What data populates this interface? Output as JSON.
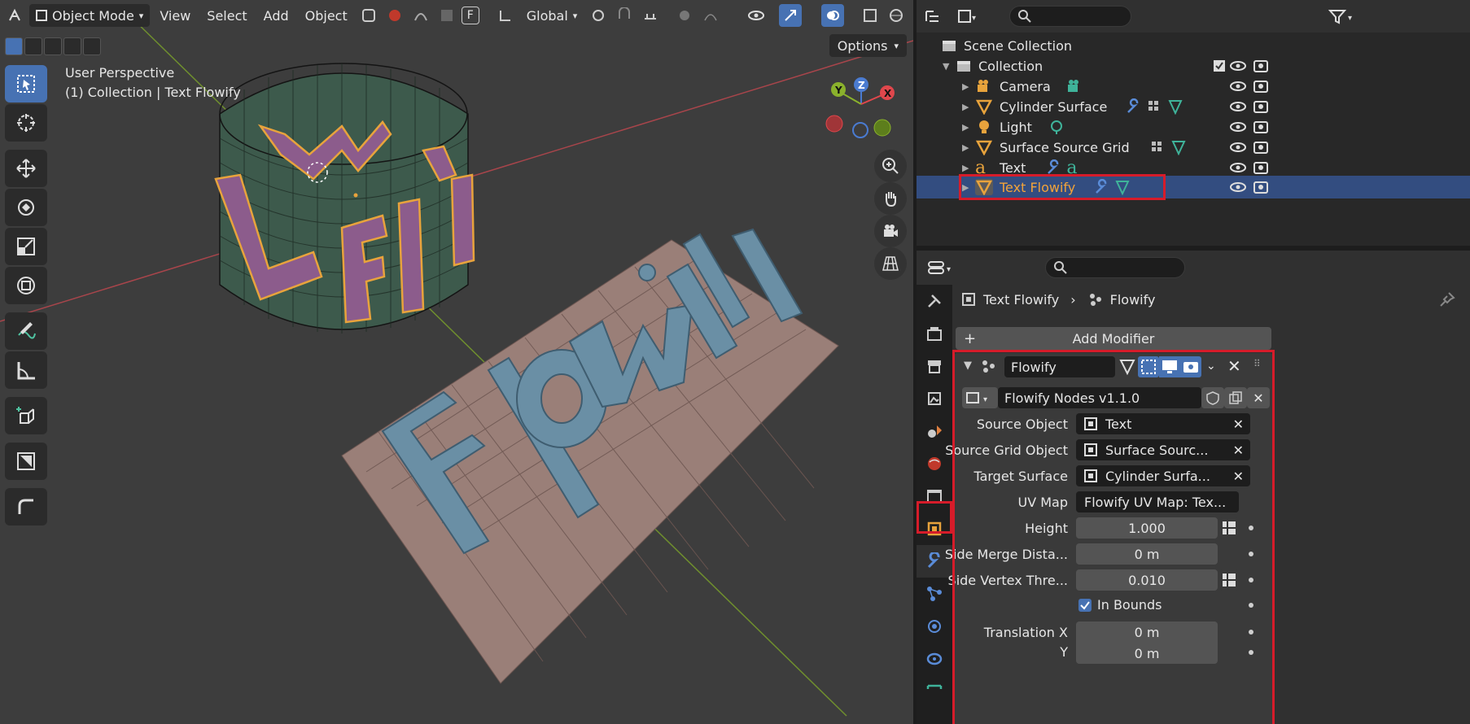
{
  "header": {
    "mode": "Object Mode",
    "menus": [
      "View",
      "Select",
      "Add",
      "Object"
    ],
    "orientation": "Global",
    "options": "Options"
  },
  "viewport": {
    "perspective": "User Perspective",
    "collection_info": "(1) Collection | Text Flowify",
    "gizmo_axes": [
      "Y",
      "Z",
      "X"
    ],
    "text_object": "Flowify"
  },
  "outliner": {
    "root": "Scene Collection",
    "collection": "Collection",
    "items": [
      {
        "label": "Camera",
        "icon": "camera-icon"
      },
      {
        "label": "Cylinder Surface",
        "icon": "mesh-icon"
      },
      {
        "label": "Light",
        "icon": "light-icon"
      },
      {
        "label": "Surface Source Grid",
        "icon": "mesh-icon"
      },
      {
        "label": "Text",
        "icon": "text-icon"
      },
      {
        "label": "Text Flowify",
        "icon": "mesh-icon",
        "selected": true
      }
    ]
  },
  "properties": {
    "breadcrumb_object": "Text Flowify",
    "breadcrumb_modifier": "Flowify",
    "add_modifier": "Add Modifier",
    "modifier_name": "Flowify",
    "node_group": "Flowify Nodes v1.1.0",
    "fields": [
      {
        "label": "Source Object",
        "value": "Text"
      },
      {
        "label": "Source Grid Object",
        "value": "Surface Sourc..."
      },
      {
        "label": "Target Surface",
        "value": "Cylinder Surfa..."
      },
      {
        "label": "UV Map",
        "value": "Flowify UV Map: Tex..."
      },
      {
        "label": "Height",
        "value": "1.000"
      },
      {
        "label": "Side Merge Dista...",
        "value": "0 m"
      },
      {
        "label": "Side Vertex Thre...",
        "value": "0.010"
      },
      {
        "label": "",
        "value": "In Bounds",
        "checked": true
      },
      {
        "label": "Translation X",
        "value": "0 m"
      },
      {
        "label": "Y",
        "value": "0 m"
      }
    ]
  },
  "colors": {
    "accent": "#4772b3",
    "selected_row": "#334d80",
    "highlight_box": "#d61c2a",
    "object_orange": "#e8a33c",
    "viewport_bg": "#3d3d3d"
  }
}
